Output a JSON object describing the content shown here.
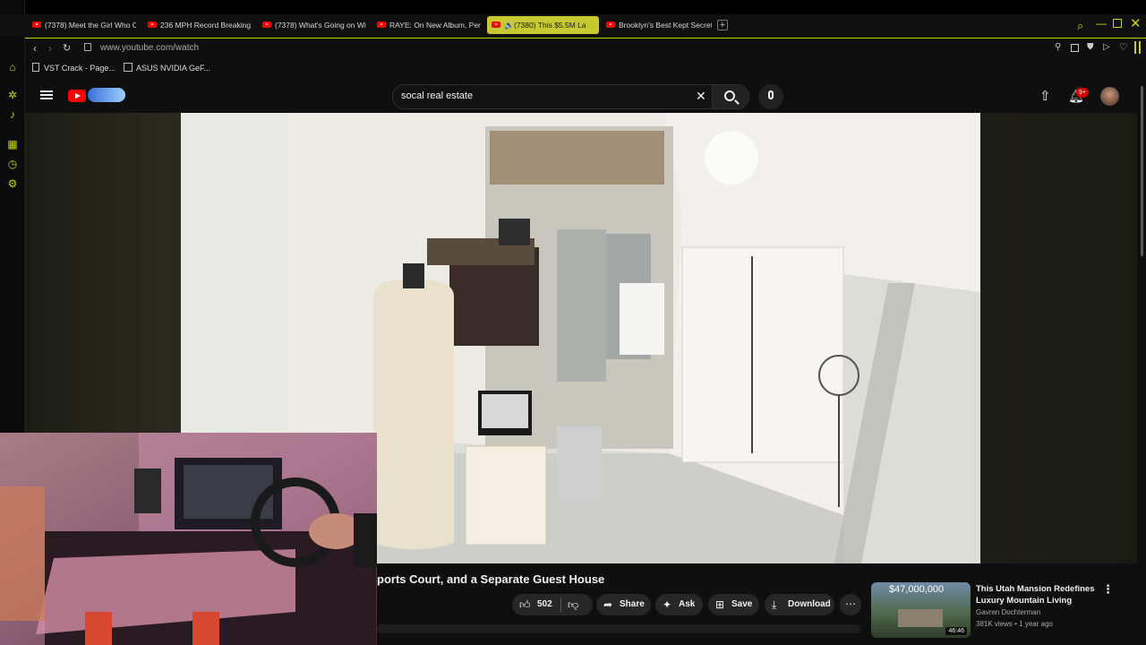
{
  "browser": {
    "tabs": [
      {
        "title": "(7378) Meet the Girl Who Ch",
        "active": false
      },
      {
        "title": "236 MPH Record Breaking Ja",
        "active": false
      },
      {
        "title": "(7378) What's Going on With",
        "active": false
      },
      {
        "title": "RAYE: On New Album, Perso",
        "active": false
      },
      {
        "title": "(7380) This $5.5M La",
        "active": true
      },
      {
        "title": "Brooklyn's Best Kept Secret",
        "active": false
      }
    ],
    "new_tab": "+",
    "url": "www.youtube.com/watch",
    "bookmarks": [
      {
        "label": "VST Crack - Page..."
      },
      {
        "label": "ASUS NVIDIA GeF..."
      }
    ]
  },
  "youtube": {
    "search_value": "socal real estate",
    "notification_badge": "9+",
    "video_title": "ports Court, and a Separate Guest House",
    "like_count": "502",
    "actions": {
      "share": "Share",
      "ask": "Ask",
      "save": "Save",
      "download": "Download"
    },
    "recommendation": {
      "thumb_price": "$47,000,000",
      "thumb_duration": "46:46",
      "title_line1": "This Utah Mansion Redefines",
      "title_line2": "Luxury Mountain Living",
      "channel": "Gavren Dochterman",
      "meta": "381K views • 1 year ago"
    }
  },
  "colors": {
    "accent": "#c8d400",
    "yt_red": "#ff0000",
    "bg": "#0f0f0f",
    "button_bg": "#272727"
  }
}
